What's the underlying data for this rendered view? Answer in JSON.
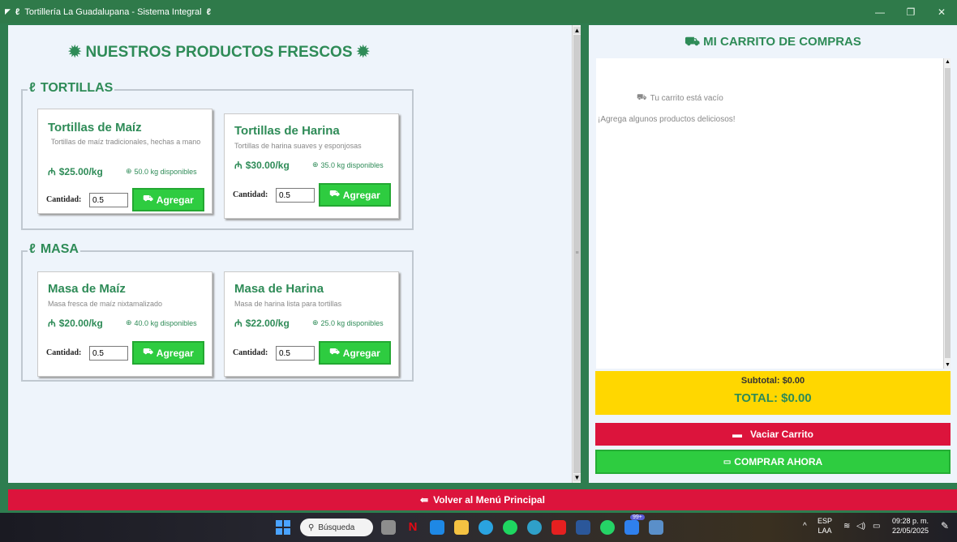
{
  "window": {
    "title": "Tortillería La Guadalupana - Sistema Integral",
    "icon_left": "leaf-icon",
    "minimize": "—",
    "maximize": "❐",
    "close": "✕"
  },
  "products": {
    "title": "NUESTROS PRODUCTOS FRESCOS",
    "title_icon": "sun-icon",
    "sections": [
      {
        "label": "TORTILLAS",
        "icon": "leaf-icon",
        "items": [
          {
            "name": "Tortillas de Maíz",
            "description": "Tortillas de maíz tradicionales, hechas a mano",
            "price": "$25.00/kg",
            "stock": "50.0 kg disponibles",
            "qty_label": "Cantidad:",
            "qty_value": "0.5",
            "add_label": "Agregar"
          },
          {
            "name": "Tortillas de Harina",
            "description": "Tortillas de harina suaves y esponjosas",
            "price": "$30.00/kg",
            "stock": "35.0 kg disponibles",
            "qty_label": "Cantidad:",
            "qty_value": "0.5",
            "add_label": "Agregar"
          }
        ]
      },
      {
        "label": "MASA",
        "icon": "leaf-icon",
        "items": [
          {
            "name": "Masa de Maíz",
            "description": "Masa fresca de maíz nixtamalizado",
            "price": "$20.00/kg",
            "stock": "40.0 kg disponibles",
            "qty_label": "Cantidad:",
            "qty_value": "0.5",
            "add_label": "Agregar"
          },
          {
            "name": "Masa de Harina",
            "description": "Masa de harina lista para tortillas",
            "price": "$22.00/kg",
            "stock": "25.0 kg disponibles",
            "qty_label": "Cantidad:",
            "qty_value": "0.5",
            "add_label": "Agregar"
          }
        ]
      }
    ]
  },
  "cart": {
    "title": "MI CARRITO DE COMPRAS",
    "empty_text": "Tu carrito está vacío",
    "hint_text": "¡Agrega algunos productos deliciosos!",
    "subtotal": "Subtotal: $0.00",
    "total": "TOTAL: $0.00",
    "clear_label": "Vaciar Carrito",
    "buy_label": "COMPRAR AHORA"
  },
  "footer": {
    "back_label": "Volver al Menú Principal"
  },
  "taskbar": {
    "search_label": "Búsqueda",
    "badge": "99+",
    "lang_line1": "ESP",
    "lang_line2": "LAA",
    "time": "09:28 p. m.",
    "date": "22/05/2025"
  },
  "colors": {
    "accent_green": "#2e8b57",
    "button_green": "#2ecc40",
    "button_red": "#dc143c",
    "total_yellow": "#ffd700",
    "window_border": "#2e7d4f"
  }
}
